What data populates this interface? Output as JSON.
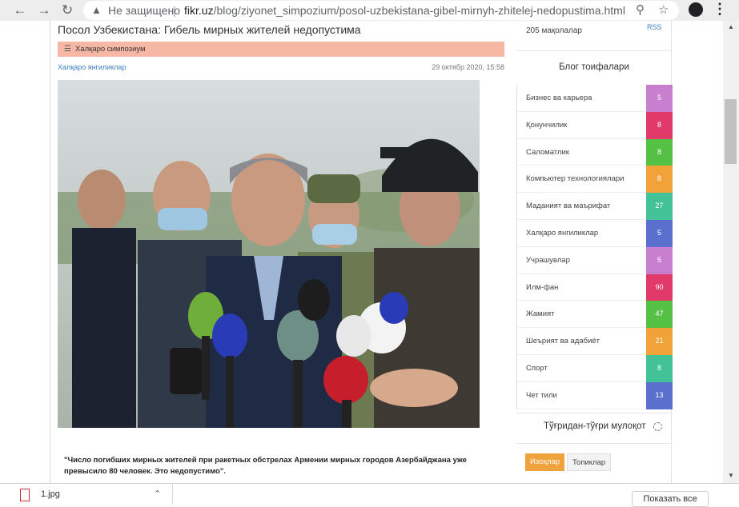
{
  "browser": {
    "security_label": "Не защищено",
    "separator": "|",
    "url_host": "fikr.uz",
    "url_path": "/blog/ziyonet_simpozium/posol-uzbekistana-gibel-mirnyh-zhitelej-nedopustima.html"
  },
  "article": {
    "title": "Посол Узбекистана: Гибель мирных жителей недопустима",
    "category_tag": "Халқаро симпозиум",
    "category_link": "Халқаро янгиликлар",
    "date": "29 октябр 2020, 15:58",
    "quote": "\"Число погибших мирных жителей при ракетных обстрелах Армении мирных городов Азербайджана уже превысило 80 человек. Это недопустимо\"."
  },
  "sidebar": {
    "count_text": "205 мақолалар",
    "rss": "RSS",
    "heading": "Блог тоифалари",
    "categories": [
      {
        "name": "Бизнес ва карьера",
        "count": "5",
        "color": "#c97fcf"
      },
      {
        "name": "Қонунчилик",
        "count": "8",
        "color": "#e0396a"
      },
      {
        "name": "Саломатлик",
        "count": "8",
        "color": "#54c145"
      },
      {
        "name": "Компьютер технологиялари",
        "count": "8",
        "color": "#f1a33a"
      },
      {
        "name": "Маданият ва маърифат",
        "count": "27",
        "color": "#43c197"
      },
      {
        "name": "Халқаро янгиликлар",
        "count": "5",
        "color": "#5b6fcf"
      },
      {
        "name": "Учрашувлар",
        "count": "5",
        "color": "#c97fcf"
      },
      {
        "name": "Илм-фан",
        "count": "90",
        "color": "#e0396a"
      },
      {
        "name": "Жамият",
        "count": "47",
        "color": "#54c145"
      },
      {
        "name": "Шеърият ва адабиёт",
        "count": "21",
        "color": "#f1a33a"
      },
      {
        "name": "Спорт",
        "count": "8",
        "color": "#43c197"
      },
      {
        "name": "Чет тили",
        "count": "13",
        "color": "#5b6fcf"
      }
    ],
    "direct_title": "Тўғридан-тўғри мулоқот",
    "tab_active": "Изоҳлар",
    "tab_inactive": "Топиклар"
  },
  "downloads": {
    "file_name": "1.jpg",
    "show_all": "Показать все"
  }
}
